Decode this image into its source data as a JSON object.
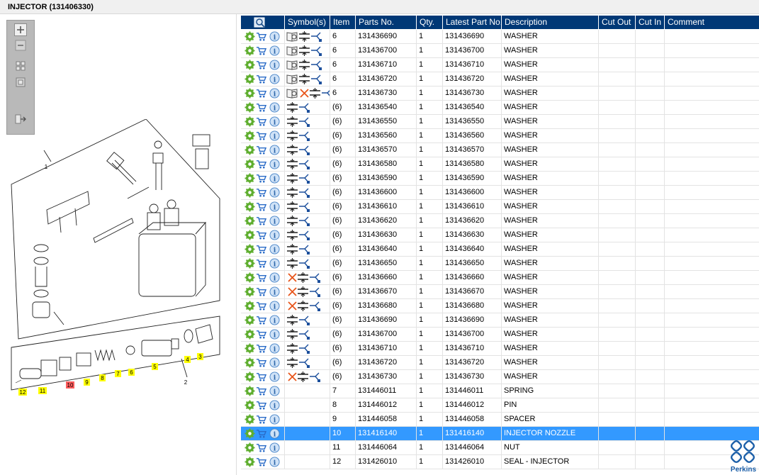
{
  "window": {
    "title": "INJECTOR (131406330)"
  },
  "columns": [
    "Symbol(s)",
    "Item",
    "Parts No.",
    "Qty.",
    "Latest Part No.",
    "Description",
    "Cut Out",
    "Cut In",
    "Comment"
  ],
  "rows": [
    {
      "symbols": [
        "book",
        "comp",
        "trans"
      ],
      "item": "6",
      "part": "131436690",
      "qty": "1",
      "latest": "131436690",
      "desc": "WASHER"
    },
    {
      "symbols": [
        "book",
        "comp",
        "trans"
      ],
      "item": "6",
      "part": "131436700",
      "qty": "1",
      "latest": "131436700",
      "desc": "WASHER"
    },
    {
      "symbols": [
        "book",
        "comp",
        "trans"
      ],
      "item": "6",
      "part": "131436710",
      "qty": "1",
      "latest": "131436710",
      "desc": "WASHER"
    },
    {
      "symbols": [
        "book",
        "comp",
        "trans"
      ],
      "item": "6",
      "part": "131436720",
      "qty": "1",
      "latest": "131436720",
      "desc": "WASHER"
    },
    {
      "symbols": [
        "book",
        "cross",
        "comp",
        "trans"
      ],
      "item": "6",
      "part": "131436730",
      "qty": "1",
      "latest": "131436730",
      "desc": "WASHER"
    },
    {
      "symbols": [
        "comp",
        "trans"
      ],
      "item": "(6)",
      "part": "131436540",
      "qty": "1",
      "latest": "131436540",
      "desc": "WASHER"
    },
    {
      "symbols": [
        "comp",
        "trans"
      ],
      "item": "(6)",
      "part": "131436550",
      "qty": "1",
      "latest": "131436550",
      "desc": "WASHER"
    },
    {
      "symbols": [
        "comp",
        "trans"
      ],
      "item": "(6)",
      "part": "131436560",
      "qty": "1",
      "latest": "131436560",
      "desc": "WASHER"
    },
    {
      "symbols": [
        "comp",
        "trans"
      ],
      "item": "(6)",
      "part": "131436570",
      "qty": "1",
      "latest": "131436570",
      "desc": "WASHER"
    },
    {
      "symbols": [
        "comp",
        "trans"
      ],
      "item": "(6)",
      "part": "131436580",
      "qty": "1",
      "latest": "131436580",
      "desc": "WASHER"
    },
    {
      "symbols": [
        "comp",
        "trans"
      ],
      "item": "(6)",
      "part": "131436590",
      "qty": "1",
      "latest": "131436590",
      "desc": "WASHER"
    },
    {
      "symbols": [
        "comp",
        "trans"
      ],
      "item": "(6)",
      "part": "131436600",
      "qty": "1",
      "latest": "131436600",
      "desc": "WASHER"
    },
    {
      "symbols": [
        "comp",
        "trans"
      ],
      "item": "(6)",
      "part": "131436610",
      "qty": "1",
      "latest": "131436610",
      "desc": "WASHER"
    },
    {
      "symbols": [
        "comp",
        "trans"
      ],
      "item": "(6)",
      "part": "131436620",
      "qty": "1",
      "latest": "131436620",
      "desc": "WASHER"
    },
    {
      "symbols": [
        "comp",
        "trans"
      ],
      "item": "(6)",
      "part": "131436630",
      "qty": "1",
      "latest": "131436630",
      "desc": "WASHER"
    },
    {
      "symbols": [
        "comp",
        "trans"
      ],
      "item": "(6)",
      "part": "131436640",
      "qty": "1",
      "latest": "131436640",
      "desc": "WASHER"
    },
    {
      "symbols": [
        "comp",
        "trans"
      ],
      "item": "(6)",
      "part": "131436650",
      "qty": "1",
      "latest": "131436650",
      "desc": "WASHER"
    },
    {
      "symbols": [
        "cross",
        "comp",
        "trans"
      ],
      "item": "(6)",
      "part": "131436660",
      "qty": "1",
      "latest": "131436660",
      "desc": "WASHER"
    },
    {
      "symbols": [
        "cross",
        "comp",
        "trans"
      ],
      "item": "(6)",
      "part": "131436670",
      "qty": "1",
      "latest": "131436670",
      "desc": "WASHER"
    },
    {
      "symbols": [
        "cross",
        "comp",
        "trans"
      ],
      "item": "(6)",
      "part": "131436680",
      "qty": "1",
      "latest": "131436680",
      "desc": "WASHER"
    },
    {
      "symbols": [
        "comp",
        "trans"
      ],
      "item": "(6)",
      "part": "131436690",
      "qty": "1",
      "latest": "131436690",
      "desc": "WASHER"
    },
    {
      "symbols": [
        "comp",
        "trans"
      ],
      "item": "(6)",
      "part": "131436700",
      "qty": "1",
      "latest": "131436700",
      "desc": "WASHER"
    },
    {
      "symbols": [
        "comp",
        "trans"
      ],
      "item": "(6)",
      "part": "131436710",
      "qty": "1",
      "latest": "131436710",
      "desc": "WASHER"
    },
    {
      "symbols": [
        "comp",
        "trans"
      ],
      "item": "(6)",
      "part": "131436720",
      "qty": "1",
      "latest": "131436720",
      "desc": "WASHER"
    },
    {
      "symbols": [
        "cross",
        "comp",
        "trans"
      ],
      "item": "(6)",
      "part": "131436730",
      "qty": "1",
      "latest": "131436730",
      "desc": "WASHER"
    },
    {
      "symbols": [],
      "item": "7",
      "part": "131446011",
      "qty": "1",
      "latest": "131446011",
      "desc": "SPRING"
    },
    {
      "symbols": [],
      "item": "8",
      "part": "131446012",
      "qty": "1",
      "latest": "131446012",
      "desc": "PIN"
    },
    {
      "symbols": [],
      "item": "9",
      "part": "131446058",
      "qty": "1",
      "latest": "131446058",
      "desc": "SPACER"
    },
    {
      "symbols": [],
      "item": "10",
      "part": "131416140",
      "qty": "1",
      "latest": "131416140",
      "desc": "INJECTOR NOZZLE",
      "selected": true
    },
    {
      "symbols": [],
      "item": "11",
      "part": "131446064",
      "qty": "1",
      "latest": "131446064",
      "desc": "NUT"
    },
    {
      "symbols": [],
      "item": "12",
      "part": "131426010",
      "qty": "1",
      "latest": "131426010",
      "desc": "SEAL - INJECTOR"
    }
  ],
  "diagram": {
    "callouts": [
      "1",
      "2",
      "3",
      "4",
      "5",
      "6",
      "7",
      "8",
      "9",
      "10",
      "11",
      "12"
    ]
  },
  "brand": {
    "name": "Perkins"
  },
  "colors": {
    "header_bg": "#003876",
    "selection": "#3399ff",
    "callout_yellow": "#ffff00",
    "callout_red": "#ff5c5c",
    "brand_blue": "#1a5ea8"
  }
}
